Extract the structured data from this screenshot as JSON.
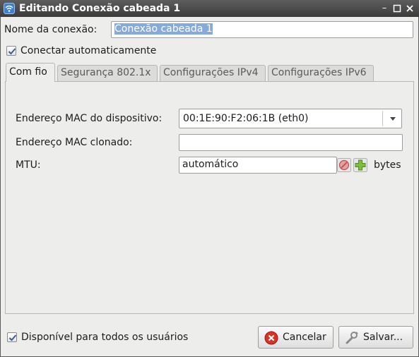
{
  "window": {
    "title": "Editando Conexão cabeada 1"
  },
  "connection_name": {
    "label": "Nome da conexão:",
    "value": "Conexão cabeada 1"
  },
  "auto_connect": {
    "label": "Conectar automaticamente",
    "checked": true
  },
  "tabs": [
    {
      "label": "Com fio",
      "active": true
    },
    {
      "label": "Segurança 802.1x",
      "active": false
    },
    {
      "label": "Configurações IPv4",
      "active": false
    },
    {
      "label": "Configurações IPv6",
      "active": false
    }
  ],
  "wired": {
    "device_mac_label": "Endereço MAC do dispositivo:",
    "device_mac_value": "00:1E:90:F2:06:1B (eth0)",
    "cloned_mac_label": "Endereço MAC clonado:",
    "cloned_mac_value": "",
    "mtu_label": "MTU:",
    "mtu_value": "automático",
    "mtu_unit": "bytes"
  },
  "all_users": {
    "label": "Disponível para todos os usuários",
    "checked": true
  },
  "buttons": {
    "cancel": "Cancelar",
    "save": "Salvar..."
  },
  "colors": {
    "selection": "#86abd9",
    "titlebar": "#4a4a4a"
  }
}
